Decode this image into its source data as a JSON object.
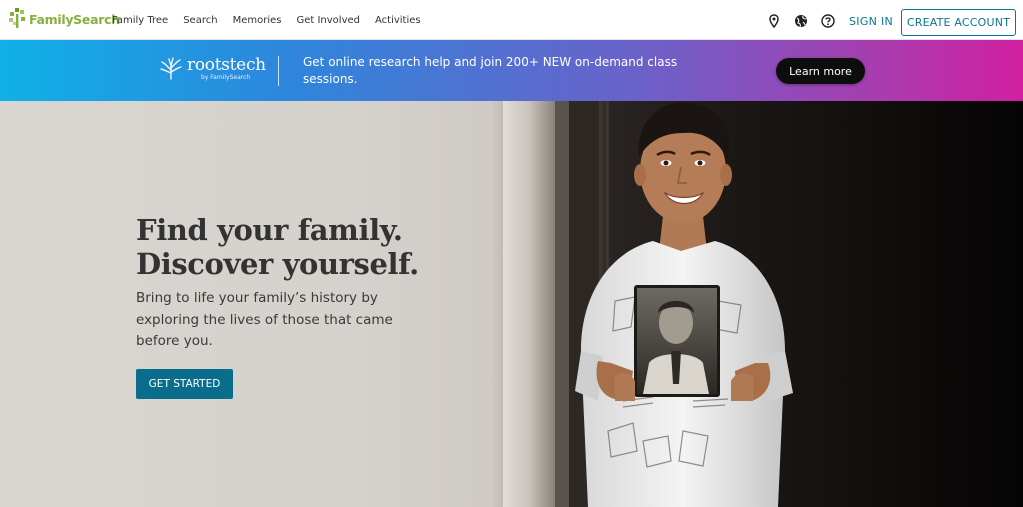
{
  "header": {
    "logo_text": "FamilySearch",
    "nav": [
      {
        "label": "Family Tree"
      },
      {
        "label": "Search"
      },
      {
        "label": "Memories"
      },
      {
        "label": "Get Involved"
      },
      {
        "label": "Activities"
      }
    ],
    "icons": [
      "location-pin-icon",
      "globe-icon",
      "help-icon"
    ],
    "sign_in": "SIGN IN",
    "create_account": "CREATE ACCOUNT"
  },
  "banner": {
    "logo_word": "rootstech",
    "logo_by": "by FamilySearch",
    "message": "Get online research help and join 200+ NEW on-demand class sessions.",
    "button": "Learn more"
  },
  "hero": {
    "title_line1": "Find your family.",
    "title_line2": "Discover yourself.",
    "subtitle": "Bring to life your family’s history by exploring the lives of those that came before you.",
    "cta": "GET STARTED"
  },
  "colors": {
    "brand_green": "#85b13e",
    "link_teal": "#0b7491",
    "cta_blue": "#0b6d8c",
    "banner_start": "#10b0e8",
    "banner_end": "#d020a0"
  }
}
